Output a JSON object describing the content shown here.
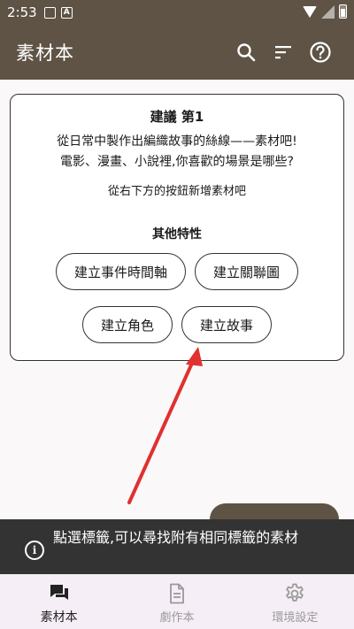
{
  "status_bar": {
    "time": "2:53"
  },
  "app_bar": {
    "title": "素材本",
    "actions": [
      "search-icon",
      "sort-icon",
      "help-icon"
    ]
  },
  "card": {
    "title": "建議 第1",
    "lines": [
      "從日常中製作出編織故事的絲線——素材吧!",
      "電影、漫畫、小說裡,你喜歡的場景是哪些?"
    ],
    "hint": "從右下方的按鈕新增素材吧",
    "subtitle": "其他特性",
    "buttons": [
      "建立事件時間軸",
      "建立關聯圖",
      "建立角色",
      "建立故事"
    ]
  },
  "snackbar": {
    "message": "點選標籤,可以尋找附有相同標籤的素材"
  },
  "bottom_nav": {
    "items": [
      {
        "label": "素材本",
        "icon": "chat-icon",
        "active": true
      },
      {
        "label": "劇作本",
        "icon": "document-icon",
        "active": false
      },
      {
        "label": "環境設定",
        "icon": "settings-icon",
        "active": false
      }
    ]
  },
  "colors": {
    "app_bar": "#5e5345",
    "arrow": "#e0302f",
    "snackbar": "#333333",
    "nav_bg": "#f6eef6"
  }
}
